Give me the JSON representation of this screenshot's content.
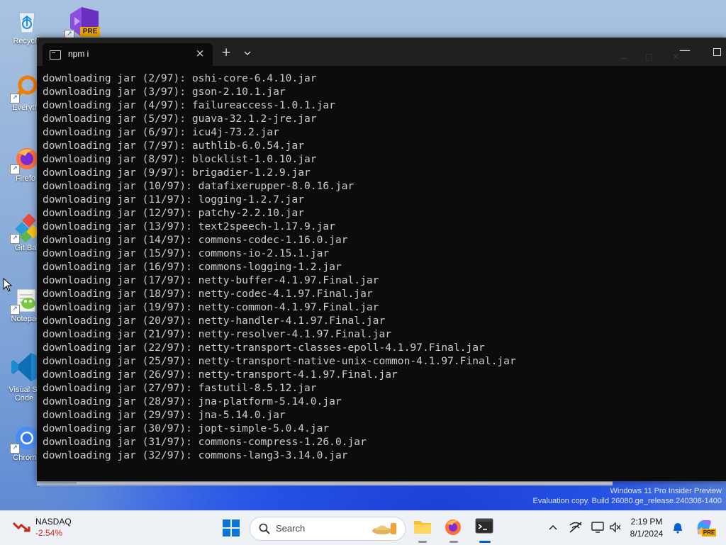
{
  "desktop": {
    "icons": [
      {
        "label": "Recycle"
      },
      {
        "label": "Everyth"
      },
      {
        "label": "Firefo"
      },
      {
        "label": "Git Ba"
      },
      {
        "label": "Notepac"
      },
      {
        "label": "Visual St",
        "label2": "Code"
      },
      {
        "label": "Chromi"
      }
    ],
    "vs_badge": "PRE",
    "watermark": {
      "line1": "Windows 11 Pro Insider Preview",
      "line2": "Evaluation copy. Build 26080.ge_release.240308-1400"
    }
  },
  "terminal": {
    "tab_title": "npm i",
    "tab_close": "×",
    "new_tab": "+",
    "dropdown": "⌄",
    "minimize": "—",
    "lines": [
      "downloading jar (2/97): oshi-core-6.4.10.jar",
      "downloading jar (3/97): gson-2.10.1.jar",
      "downloading jar (4/97): failureaccess-1.0.1.jar",
      "downloading jar (5/97): guava-32.1.2-jre.jar",
      "downloading jar (6/97): icu4j-73.2.jar",
      "downloading jar (7/97): authlib-6.0.54.jar",
      "downloading jar (8/97): blocklist-1.0.10.jar",
      "downloading jar (9/97): brigadier-1.2.9.jar",
      "downloading jar (10/97): datafixerupper-8.0.16.jar",
      "downloading jar (11/97): logging-1.2.7.jar",
      "downloading jar (12/97): patchy-2.2.10.jar",
      "downloading jar (13/97): text2speech-1.17.9.jar",
      "downloading jar (14/97): commons-codec-1.16.0.jar",
      "downloading jar (15/97): commons-io-2.15.1.jar",
      "downloading jar (16/97): commons-logging-1.2.jar",
      "downloading jar (17/97): netty-buffer-4.1.97.Final.jar",
      "downloading jar (18/97): netty-codec-4.1.97.Final.jar",
      "downloading jar (19/97): netty-common-4.1.97.Final.jar",
      "downloading jar (20/97): netty-handler-4.1.97.Final.jar",
      "downloading jar (21/97): netty-resolver-4.1.97.Final.jar",
      "downloading jar (22/97): netty-transport-classes-epoll-4.1.97.Final.jar",
      "downloading jar (25/97): netty-transport-native-unix-common-4.1.97.Final.jar",
      "downloading jar (26/97): netty-transport-4.1.97.Final.jar",
      "downloading jar (27/97): fastutil-8.5.12.jar",
      "downloading jar (28/97): jna-platform-5.14.0.jar",
      "downloading jar (29/97): jna-5.14.0.jar",
      "downloading jar (30/97): jopt-simple-5.0.4.jar",
      "downloading jar (31/97): commons-compress-1.26.0.jar",
      "downloading jar (32/97): commons-lang3-3.14.0.jar"
    ]
  },
  "taskbar": {
    "stock_name": "NASDAQ",
    "stock_change": "-2.54%",
    "search_placeholder": "Search",
    "time": "2:19 PM",
    "date": "8/1/2024",
    "copilot_badge": "PRE",
    "colors": {
      "accent": "#005fb8",
      "negative": "#c42b1c"
    }
  }
}
